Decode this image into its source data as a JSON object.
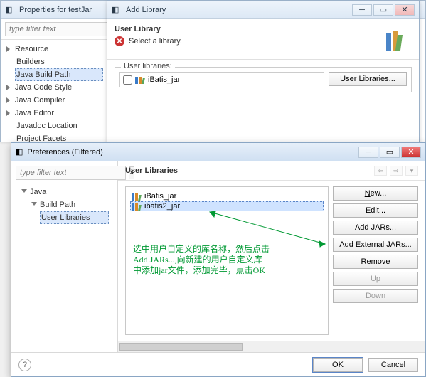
{
  "props_window": {
    "title": "Properties for testJar",
    "filter_placeholder": "type filter text",
    "tree": {
      "resource": "Resource",
      "builders": "Builders",
      "java_build_path": "Java Build Path",
      "java_code_style": "Java Code Style",
      "java_compiler": "Java Compiler",
      "java_editor": "Java Editor",
      "javadoc_location": "Javadoc Location",
      "project_facets": "Project Facets"
    }
  },
  "addlib_window": {
    "title": "Add Library",
    "header_title": "User Library",
    "header_msg": "Select a library.",
    "group_label": "User libraries:",
    "lib_item": "iBatis_jar",
    "btn_user_libraries": "User Libraries..."
  },
  "prefs_window": {
    "title": "Preferences (Filtered)",
    "filter_placeholder": "type filter text",
    "tree": {
      "java": "Java",
      "build_path": "Build Path",
      "user_libraries": "User Libraries"
    },
    "section_title": "User Libraries",
    "libs": {
      "item1": "iBatis_jar",
      "item2": "ibatis2_jar"
    },
    "buttons": {
      "new": "New...",
      "edit": "Edit...",
      "add_jars": "Add JARs...",
      "add_ext_jars": "Add External JARs...",
      "remove": "Remove",
      "up": "Up",
      "down": "Down"
    },
    "footer": {
      "ok": "OK",
      "cancel": "Cancel"
    }
  },
  "annotation": "选中用户自定义的库名称，然后点击\nAdd JARs...,向新建的用户自定义库\n中添加jar文件，添加完毕，点击OK"
}
